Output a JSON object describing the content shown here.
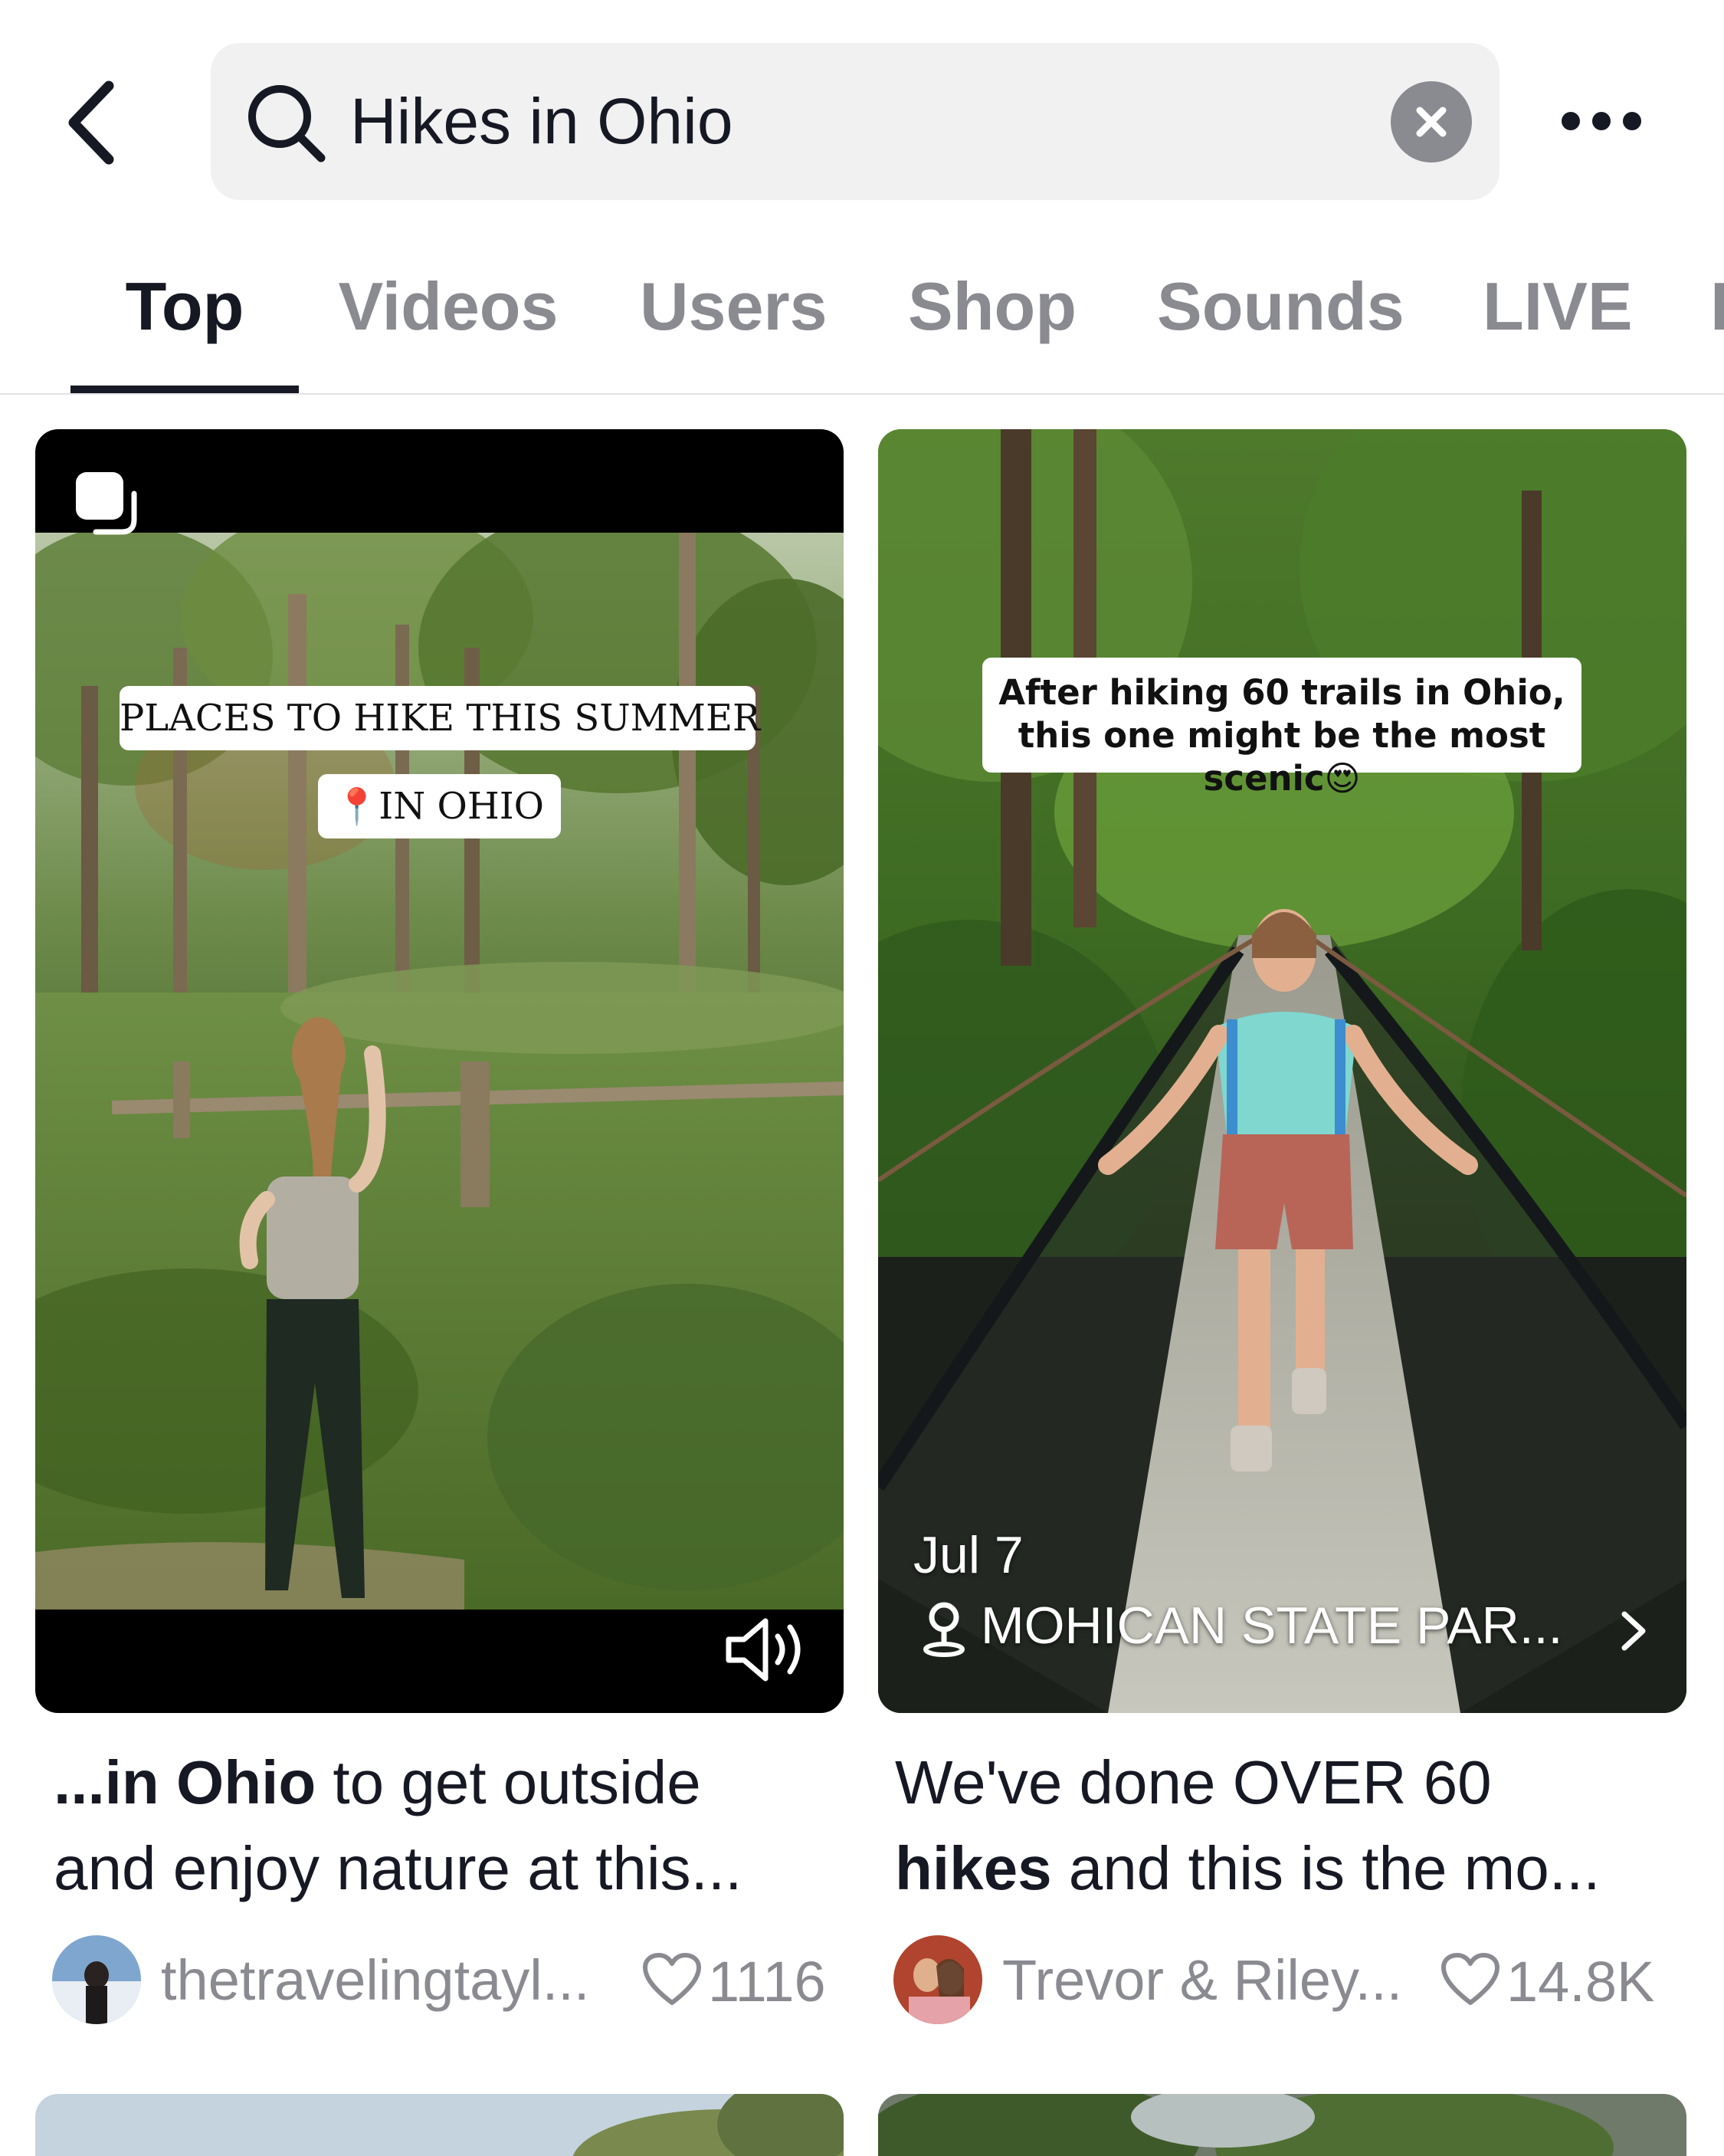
{
  "search": {
    "query": "Hikes in Ohio"
  },
  "icons": {
    "back": "chevron-left-icon",
    "search": "search-icon",
    "clear": "close-circle-icon",
    "more": "more-horizontal-icon",
    "carousel": "photo-carousel-icon",
    "sound": "speaker-icon",
    "location": "location-pin-icon",
    "like": "heart-icon"
  },
  "tabs": [
    {
      "label": "Top",
      "active": true
    },
    {
      "label": "Videos",
      "active": false
    },
    {
      "label": "Users",
      "active": false
    },
    {
      "label": "Shop",
      "active": false
    },
    {
      "label": "Sounds",
      "active": false
    },
    {
      "label": "LIVE",
      "active": false
    },
    {
      "label": "I",
      "active": false
    }
  ],
  "results": [
    {
      "overlay_title": "PLACES TO HIKE THIS SUMMER",
      "overlay_subtitle": "IN OHIO",
      "overlay_pin": "📍",
      "caption_bold_1": "...in Ohio",
      "caption_rest_1": " to get outside",
      "caption_line_2": "and enjoy nature at this...",
      "author": "thetravelingtayl...",
      "likes": "1116"
    },
    {
      "overlay_text": "After hiking 60 trails in Ohio, this one might be the most scenic😍",
      "date": "Jul 7",
      "location": "MOHICAN STATE PAR...",
      "caption_line_1": "We've done OVER 60",
      "caption_bold_2": "hikes",
      "caption_rest_2": " and this is the mo...",
      "author": "Trevor & Riley...",
      "likes": "14.8K"
    }
  ],
  "colors": {
    "text_primary": "#161823",
    "text_secondary": "#8a8b91",
    "search_bg": "#f1f1f2",
    "tab_indicator": "#161823"
  }
}
